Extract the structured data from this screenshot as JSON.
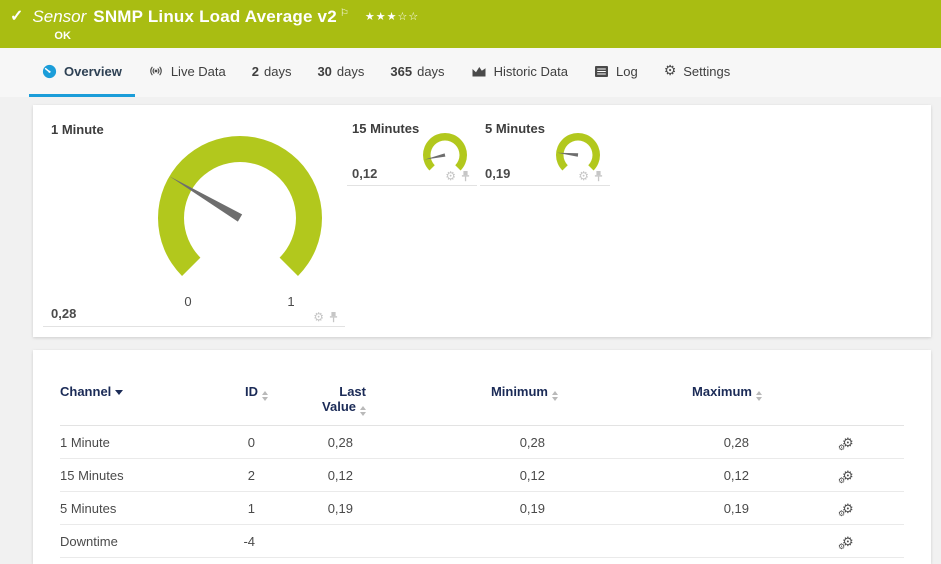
{
  "header": {
    "kicker": "Sensor",
    "title": "SNMP Linux Load Average v2",
    "status": "OK",
    "rating": {
      "filled": 3,
      "total": 5
    }
  },
  "icons": {
    "status_check": "✓",
    "flag": "⚐",
    "star_filled": "★",
    "star_empty": "☆",
    "gear": "⚙",
    "overview_tab": "gauge-dial",
    "live_data_tab": "broadcast-waves",
    "historic_data_tab": "area-chart",
    "log_tab": "list-page",
    "settings_tab": "gear",
    "card_actions": [
      "gear",
      "pushpin"
    ],
    "channel_settings": "double-gear",
    "sort_active": "triangle-down",
    "sort_inactive": "triangle-up-down"
  },
  "colors": {
    "header_bg": "#a9bd12",
    "gauge_arc": "#b2c81d",
    "needle": "#6e6e6e",
    "accent_blue": "#1b9dd9",
    "table_header_text": "#1b2b57"
  },
  "tabs": [
    {
      "id": "overview",
      "label": "Overview",
      "icon": "gauge-icon",
      "active": true
    },
    {
      "id": "live-data",
      "label": "Live Data",
      "icon": "live-icon",
      "active": false
    },
    {
      "id": "2-days",
      "bold": "2",
      "label": "days",
      "active": false
    },
    {
      "id": "30-days",
      "bold": "30",
      "label": "days",
      "active": false
    },
    {
      "id": "365-days",
      "bold": "365",
      "label": "days",
      "active": false
    },
    {
      "id": "historic-data",
      "label": "Historic Data",
      "icon": "chart-icon",
      "active": false
    },
    {
      "id": "log",
      "label": "Log",
      "icon": "log-icon",
      "active": false
    },
    {
      "id": "settings",
      "label": "Settings",
      "icon": "gear-icon",
      "active": false
    }
  ],
  "gauges": [
    {
      "name": "1 Minute",
      "value_label": "0,28",
      "value": 0.28,
      "min": 0,
      "max": 1,
      "size": "large",
      "ticks": [
        "0",
        "1"
      ]
    },
    {
      "name": "15 Minutes",
      "value_label": "0,12",
      "value": 0.12,
      "min": 0,
      "max": 1,
      "size": "small",
      "ticks": []
    },
    {
      "name": "5 Minutes",
      "value_label": "0,19",
      "value": 0.19,
      "min": 0,
      "max": 1,
      "size": "small",
      "ticks": []
    }
  ],
  "table": {
    "columns": [
      {
        "label": "Channel",
        "sort": "active"
      },
      {
        "label": "ID",
        "sort": "inactive"
      },
      {
        "label": "Last Value",
        "lines": [
          "Last",
          "Value"
        ],
        "sort": "inactive"
      },
      {
        "label": "Minimum",
        "sort": "inactive"
      },
      {
        "label": "Maximum",
        "sort": "inactive"
      }
    ],
    "rows": [
      {
        "channel": "1 Minute",
        "id": "0",
        "last_value": "0,28",
        "minimum": "0,28",
        "maximum": "0,28"
      },
      {
        "channel": "15 Minutes",
        "id": "2",
        "last_value": "0,12",
        "minimum": "0,12",
        "maximum": "0,12"
      },
      {
        "channel": "5 Minutes",
        "id": "1",
        "last_value": "0,19",
        "minimum": "0,19",
        "maximum": "0,19"
      },
      {
        "channel": "Downtime",
        "id": "-4",
        "last_value": "",
        "minimum": "",
        "maximum": ""
      }
    ]
  }
}
